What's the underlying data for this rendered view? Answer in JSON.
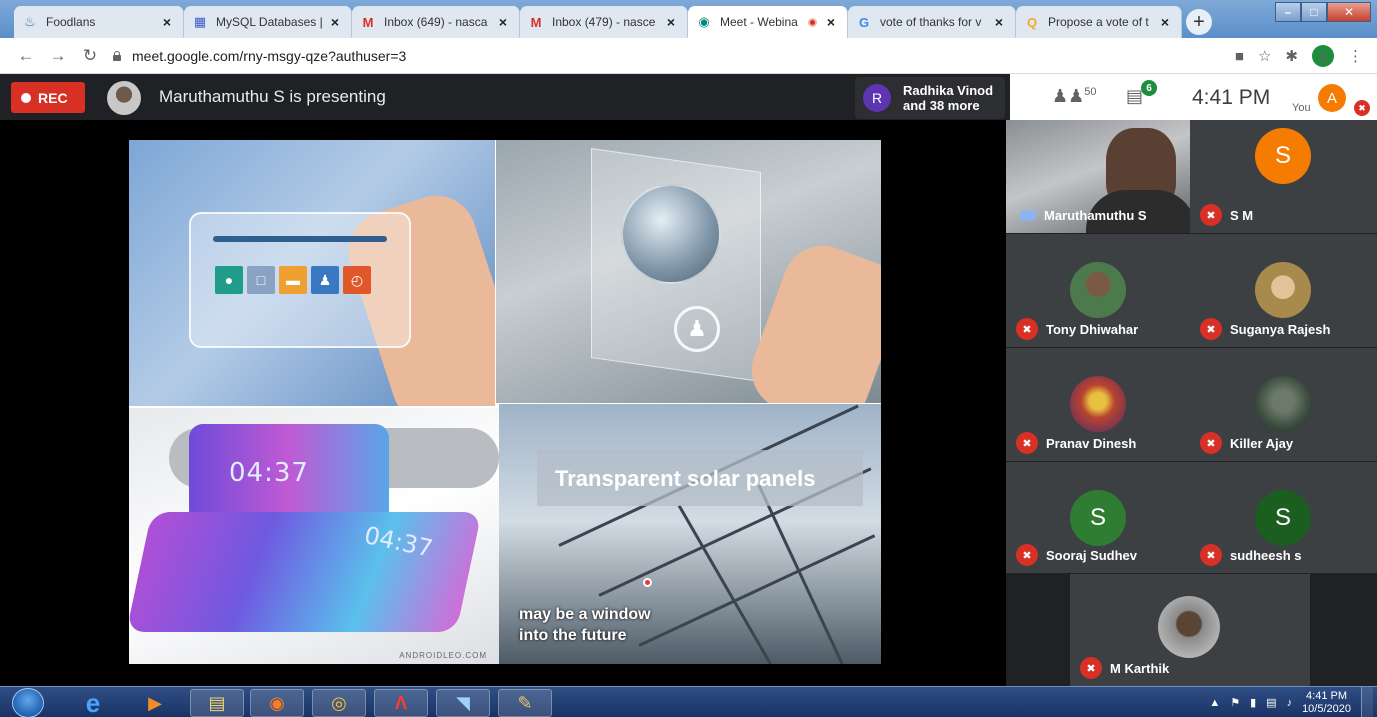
{
  "browser": {
    "tabs": [
      {
        "label": "Foodlans",
        "icon": "foodlans-icon",
        "color": "#3b6db5"
      },
      {
        "label": "MySQL Databases |",
        "icon": "mysql-icon",
        "color": "#3a5ec7"
      },
      {
        "label": "Inbox (649) - nasca",
        "icon": "gmail-icon",
        "color": "#d93025"
      },
      {
        "label": "Inbox (479) - nasce",
        "icon": "gmail-icon",
        "color": "#d93025"
      },
      {
        "label": "Meet - Webina",
        "icon": "meet-icon",
        "color": "#00897b",
        "active": true
      },
      {
        "label": "vote of thanks for v",
        "icon": "google-icon",
        "color": "#4285f4"
      },
      {
        "label": "Propose a vote of t",
        "icon": "quora-icon",
        "color": "#f9a825"
      }
    ],
    "url": "meet.google.com/rny-msgy-qze?authuser=3",
    "account_initial": "a"
  },
  "meet": {
    "rec_label": "REC",
    "presenter_text": "Maruthamuthu S is presenting",
    "join": {
      "initial": "R",
      "line1": "Radhika Vinod",
      "line2": "and 38 more"
    },
    "people_count": "50",
    "chat_badge": "6",
    "time": "4:41 PM",
    "you_label": "You",
    "you_initial": "A",
    "accent": "#1a73e8",
    "mute_color": "#d93025"
  },
  "slide": {
    "clock_text_1": "04:37",
    "clock_text_2": "04:37",
    "watermark": "ANDROIDLEO.COM",
    "solar_title": "Transparent solar panels",
    "solar_sub_1": "may be a window",
    "solar_sub_2": "into the future"
  },
  "participants": [
    {
      "name": "Maruthamuthu S",
      "speaking": true,
      "type": "video"
    },
    {
      "name": "S M",
      "initial": "S",
      "avatar_color": "#f57c00",
      "type": "initial"
    },
    {
      "name": "Tony Dhiwahar",
      "type": "photo",
      "photo_color": "#4d7a4d"
    },
    {
      "name": "Suganya Rajesh",
      "type": "photo",
      "photo_color": "#a88a4c"
    },
    {
      "name": "Pranav Dinesh",
      "type": "photo",
      "photo_color": "#b8432f"
    },
    {
      "name": "Killer Ajay",
      "type": "photo",
      "photo_color": "#3c4f40"
    },
    {
      "name": "Sooraj Sudhev",
      "initial": "S",
      "avatar_color": "#2e7d32",
      "type": "initial"
    },
    {
      "name": "sudheesh s",
      "initial": "S",
      "avatar_color": "#1b5e20",
      "type": "initial"
    },
    {
      "name": "M Karthik",
      "type": "photo",
      "photo_color": "#8a8a8a"
    }
  ],
  "taskbar": {
    "apps": [
      "ie-icon",
      "media-player-icon",
      "file-explorer-icon",
      "firefox-icon",
      "chrome-icon",
      "acrobat-icon",
      "window-icon",
      "paint-icon"
    ],
    "clock_time": "4:41 PM",
    "clock_date": "10/5/2020"
  }
}
